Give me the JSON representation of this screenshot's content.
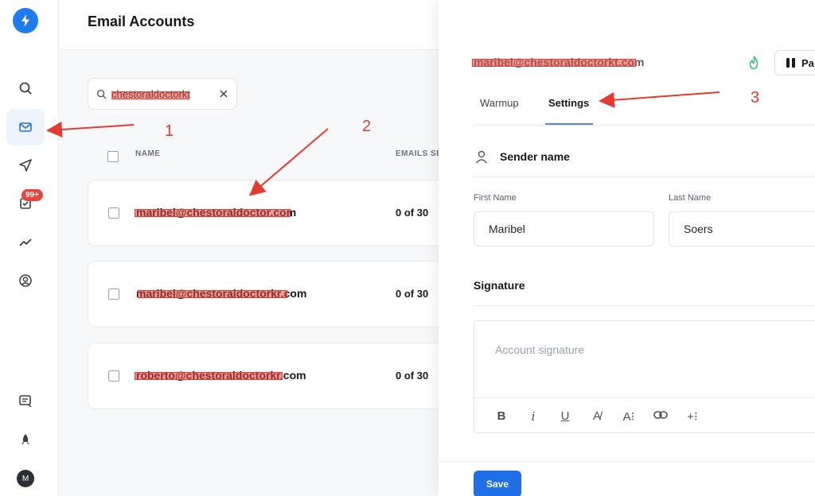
{
  "sidebar": {
    "badge": "99+",
    "avatar_initial": "M"
  },
  "header": {
    "title": "Email Accounts"
  },
  "search": {
    "value": "chestoraldoctorkt"
  },
  "list": {
    "columns": [
      "NAME",
      "EMAILS SE"
    ],
    "rows": [
      {
        "email": "maribel@chestoraldoctor.com",
        "count": "0  of  30"
      },
      {
        "email": "maribel@chestoraldoctorkr.com",
        "count": "0  of  30"
      },
      {
        "email": "roberto@chestoraldoctorkr.com",
        "count": "0  of  30"
      }
    ]
  },
  "panel": {
    "email": "maribel@chestoraldoctorkt.com",
    "pause_label": "Pa",
    "tabs": [
      "Warmup",
      "Settings"
    ],
    "active_tab": "Settings",
    "sender_section": "Sender name",
    "first_name_label": "First Name",
    "first_name_value": "Maribel",
    "last_name_label": "Last Name",
    "last_name_value": "Soers",
    "signature_section": "Signature",
    "signature_placeholder": "Account signature",
    "toolbar": [
      "B",
      "i",
      "U",
      "A̸",
      "A⁝",
      "⊂⊃",
      "+⁝"
    ],
    "save_label": "Save"
  },
  "annotations": [
    "1",
    "2",
    "3"
  ],
  "colors": {
    "accent": "#1e6fe8",
    "annotation": "#e33b2f",
    "flame": "#3fbf7f"
  }
}
